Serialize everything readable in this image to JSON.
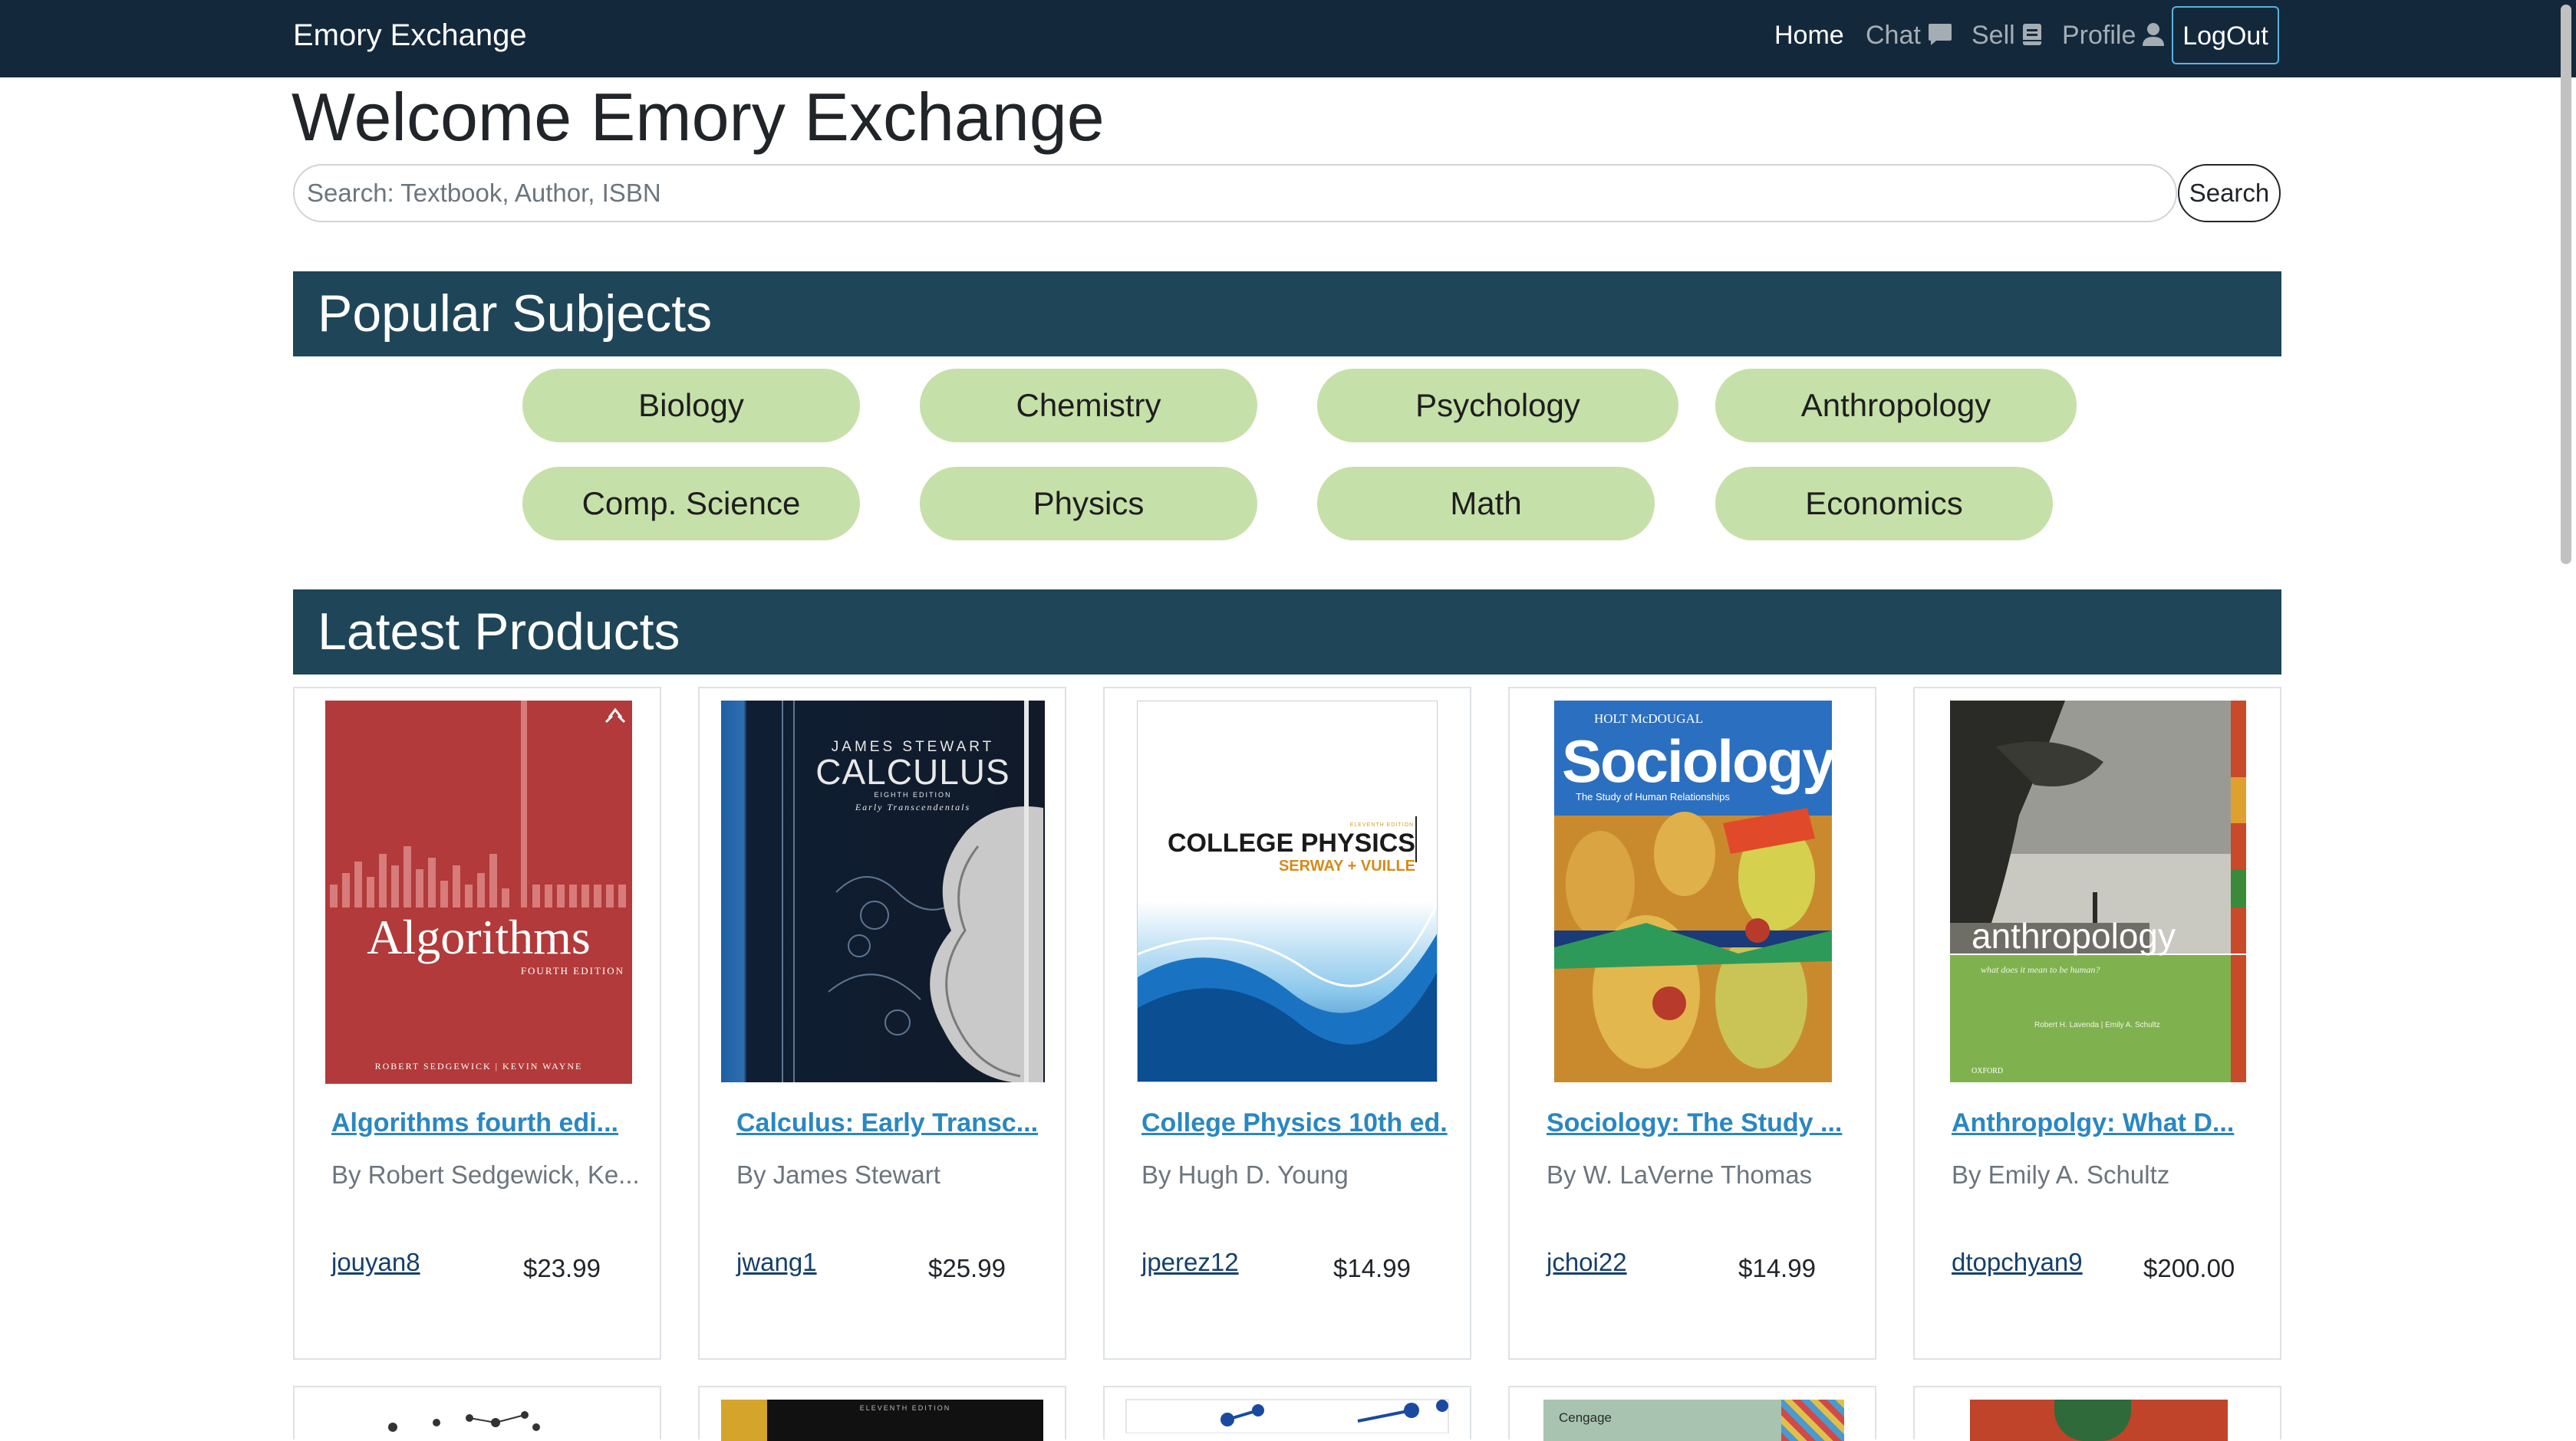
{
  "navbar": {
    "brand": "Emory Exchange",
    "items": [
      {
        "label": "Home",
        "icon": ""
      },
      {
        "label": "Chat",
        "icon": "chat-bubble-icon"
      },
      {
        "label": "Sell",
        "icon": "book-icon"
      },
      {
        "label": "Profile",
        "icon": "user-icon"
      }
    ],
    "logout": "LogOut"
  },
  "page_title": "Welcome Emory Exchange",
  "search": {
    "placeholder": "Search: Textbook, Author, ISBN",
    "value": "",
    "button": "Search"
  },
  "popular_subjects": {
    "heading": "Popular Subjects",
    "subjects": [
      "Biology",
      "Chemistry",
      "Psychology",
      "Anthropology",
      "Comp. Science",
      "Physics",
      "Math",
      "Economics"
    ]
  },
  "latest_products": {
    "heading": "Latest Products",
    "products": [
      {
        "title": "Algorithms fourth edi...",
        "author": "By Robert Sedgewick, Ke...",
        "seller": "jouyan8",
        "price": "$23.99",
        "cover": {
          "title": "Algorithms",
          "subtitle": "FOURTH EDITION",
          "credits": "ROBERT SEDGEWICK | KEVIN WAYNE"
        }
      },
      {
        "title": "Calculus: Early Transc...",
        "author": "By James Stewart",
        "seller": "jwang1",
        "price": "$25.99",
        "cover": {
          "author": "JAMES STEWART",
          "title": "CALCULUS",
          "edition": "EIGHTH EDITION",
          "subtitle": "Early Transcendentals"
        }
      },
      {
        "title": "College Physics 10th ed.",
        "author": "By Hugh D. Young",
        "seller": "jperez12",
        "price": "$14.99",
        "cover": {
          "edition": "ELEVENTH EDITION",
          "title": "COLLEGE PHYSICS",
          "authors": "SERWAY + VUILLE"
        }
      },
      {
        "title": "Sociology: The Study ...",
        "author": "By W. LaVerne Thomas",
        "seller": "jchoi22",
        "price": "$14.99",
        "cover": {
          "publisher": "HOLT McDOUGAL",
          "title": "Sociology",
          "subtitle": "The Study of Human Relationships"
        }
      },
      {
        "title": "Anthropolgy: What D...",
        "author": "By Emily A. Schultz",
        "seller": "dtopchyan9",
        "price": "$200.00",
        "cover": {
          "title": "anthropology",
          "subtitle": "what does it mean to be human?",
          "authors": "Robert H. Lavenda | Emily A. Schultz",
          "publisher": "OXFORD"
        }
      }
    ],
    "partial_covers": {
      "edition": "ELEVENTH EDITION",
      "publisher": "Cengage"
    }
  },
  "colors": {
    "navbar": "#14283c",
    "section_header": "#1f4558",
    "pill": "#c6e0a9",
    "link": "#2a87c1",
    "seller_link": "#15406b",
    "logout_border": "#5bb3e0"
  }
}
